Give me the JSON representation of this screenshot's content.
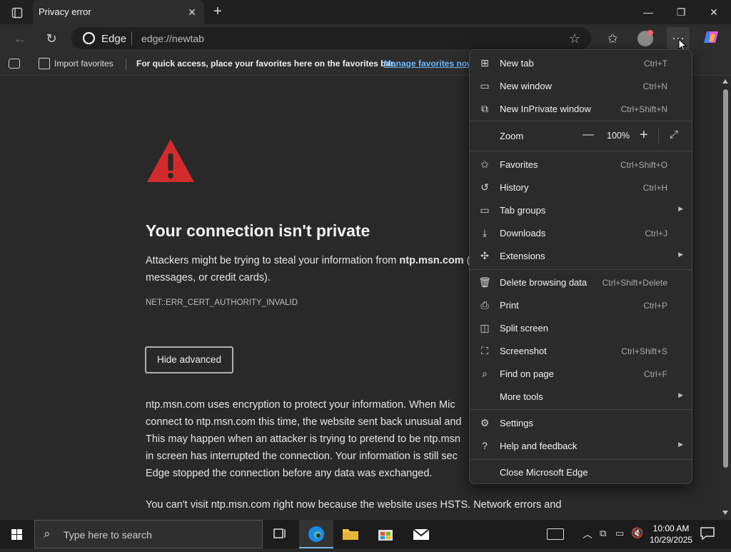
{
  "tab": {
    "title": "Privacy error"
  },
  "address_bar": {
    "site_name": "Edge",
    "url": "edge://newtab"
  },
  "favorites_bar": {
    "import_label": "Import favorites",
    "message": "For quick access, place your favorites here on the favorites bar.",
    "manage_link": "Manage favorites now"
  },
  "page": {
    "heading": "Your connection isn't private",
    "intro_prefix": "Attackers might be trying to steal your information from ",
    "intro_domain": "ntp.msn.com",
    "intro_suffix": " (fo",
    "intro_line2": "messages, or credit cards).",
    "error_code": "NET::ERR_CERT_AUTHORITY_INVALID",
    "hide_advanced_button": "Hide advanced",
    "advanced_lines": [
      "ntp.msn.com uses encryption to protect your information. When Mic",
      "connect to ntp.msn.com this time, the website sent back unusual and",
      "This may happen when an attacker is trying to pretend to be ntp.msn",
      "in screen has interrupted the connection. Your information is still sec",
      "Edge stopped the connection before any data was exchanged."
    ],
    "hsts_line": "You can't visit ntp.msn.com right now because the website uses HSTS. Network errors and"
  },
  "menu": {
    "items": [
      {
        "label": "New tab",
        "shortcut": "Ctrl+T",
        "icon": "new-tab-icon"
      },
      {
        "label": "New window",
        "shortcut": "Ctrl+N",
        "icon": "new-window-icon"
      },
      {
        "label": "New InPrivate window",
        "shortcut": "Ctrl+Shift+N",
        "icon": "inprivate-icon"
      },
      {
        "label": "Favorites",
        "shortcut": "Ctrl+Shift+O",
        "icon": "favorites-icon"
      },
      {
        "label": "History",
        "shortcut": "Ctrl+H",
        "icon": "history-icon"
      },
      {
        "label": "Tab groups",
        "shortcut": "",
        "icon": "tab-groups-icon"
      },
      {
        "label": "Downloads",
        "shortcut": "Ctrl+J",
        "icon": "download-icon"
      },
      {
        "label": "Extensions",
        "shortcut": "",
        "icon": "extensions-icon"
      },
      {
        "label": "Delete browsing data",
        "shortcut": "Ctrl+Shift+Delete",
        "icon": "trash-icon"
      },
      {
        "label": "Print",
        "shortcut": "Ctrl+P",
        "icon": "print-icon"
      },
      {
        "label": "Split screen",
        "shortcut": "",
        "icon": "split-screen-icon"
      },
      {
        "label": "Screenshot",
        "shortcut": "Ctrl+Shift+S",
        "icon": "screenshot-icon"
      },
      {
        "label": "Find on page",
        "shortcut": "Ctrl+F",
        "icon": "find-icon"
      },
      {
        "label": "More tools",
        "shortcut": "",
        "icon": ""
      },
      {
        "label": "Settings",
        "shortcut": "",
        "icon": "settings-icon"
      },
      {
        "label": "Help and feedback",
        "shortcut": "",
        "icon": "help-icon"
      },
      {
        "label": "Close Microsoft Edge",
        "shortcut": "",
        "icon": ""
      }
    ],
    "zoom": {
      "label": "Zoom",
      "value": "100%",
      "minus": "—",
      "plus": "+"
    }
  },
  "taskbar": {
    "search_placeholder": "Type here to search",
    "time": "10:00 AM",
    "date": "10/29/2025"
  },
  "colors": {
    "warning_red": "#d12b2b",
    "link_blue": "#6cb8ff",
    "page_bg": "#292929"
  }
}
